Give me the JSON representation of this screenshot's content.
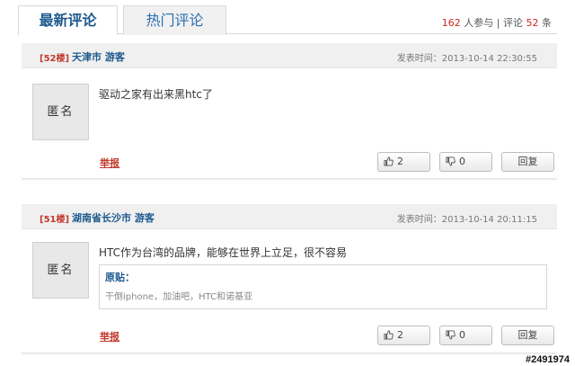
{
  "tabs": {
    "latest": "最新评论",
    "hot": "热门评论"
  },
  "stats": {
    "participants": "162",
    "participants_label": " 人参与 | 评论 ",
    "comments": "52",
    "comments_label": " 条"
  },
  "comments": [
    {
      "floor": "[52楼]",
      "location": "天津市 游客",
      "time": "发表时间：2013-10-14 22:30:55",
      "avatar": "匿名",
      "text": "驱动之家有出来黑htc了",
      "report": "举报",
      "likes": "2",
      "dislikes": "0",
      "reply": "回复"
    },
    {
      "floor": "[51楼]",
      "location": "湖南省长沙市 游客",
      "time": "发表时间：2013-10-14 20:11:15",
      "avatar": "匿名",
      "text": "HTC作为台湾的品牌，能够在世界上立足，很不容易",
      "quote_title": "原贴：",
      "quote_text": "干倒iphone，加油吧，HTC和诺基亚",
      "report": "举报",
      "likes": "2",
      "dislikes": "0",
      "reply": "回复"
    }
  ],
  "watermark": "#2491974",
  "icons": {
    "like": "thumbs-up-icon",
    "dislike": "thumbs-down-icon"
  },
  "colors": {
    "accent": "#1d5a8e",
    "highlight": "#d0261c"
  }
}
